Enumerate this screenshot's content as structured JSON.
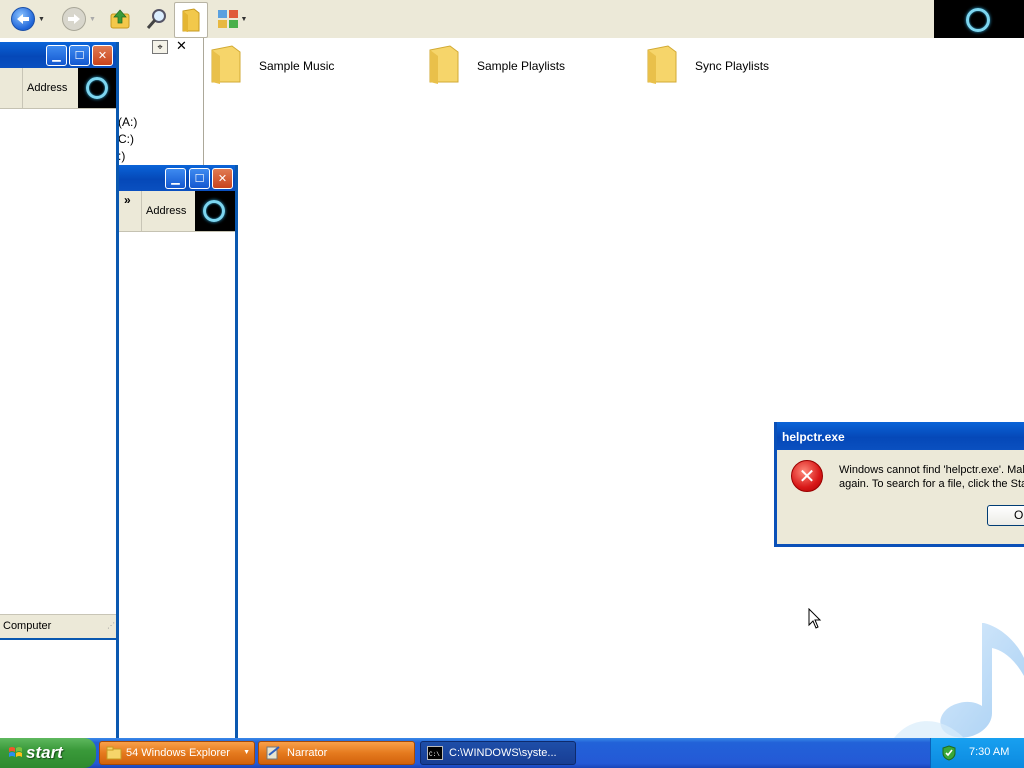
{
  "toolbar": {
    "back_icon": "back-arrow-icon",
    "forward_icon": "forward-arrow-icon",
    "up_icon": "folder-up-icon",
    "search_icon": "search-icon",
    "folders_icon": "folders-icon",
    "views_icon": "views-icon"
  },
  "left_pane": {
    "drives": [
      "(A:)",
      "C:)",
      ":)"
    ]
  },
  "content": {
    "folders": [
      {
        "label": "Sample Music"
      },
      {
        "label": "Sample Playlists"
      },
      {
        "label": "Sync Playlists"
      }
    ]
  },
  "window1": {
    "address_label": "Address",
    "status_text": "Computer"
  },
  "window2": {
    "chevron": "»",
    "address_label": "Address"
  },
  "dialog": {
    "title": "helpctr.exe",
    "message_line1": "Windows cannot find 'helpctr.exe'. Mak",
    "message_line2": "again. To search for a file, click the Sta",
    "ok_label": "Ok"
  },
  "taskbar": {
    "start_label": "start",
    "tasks": [
      {
        "label": "54 Windows Explorer"
      },
      {
        "label": "Narrator"
      },
      {
        "label": "C:\\WINDOWS\\syste..."
      }
    ],
    "clock": "7:30 AM"
  },
  "colors": {
    "xp_blue": "#0a58b0",
    "taskbar_blue": "#2459d6",
    "start_green": "#3a9a3a",
    "task_orange": "#e57a1e"
  }
}
